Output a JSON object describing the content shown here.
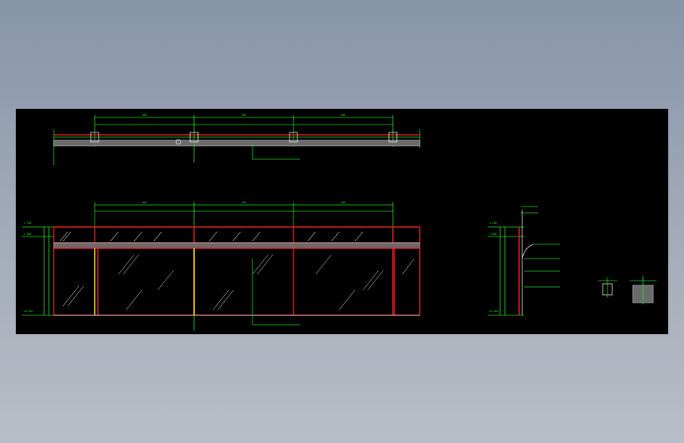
{
  "colors": {
    "canvas": "#000000",
    "dimension": "#22dd22",
    "frame": "#ff2222",
    "post": "#ffe000",
    "annotation": "#e8e8e8"
  },
  "plan_view": {
    "spans": [
      "600",
      "600",
      "600"
    ],
    "notes": [
      "",
      "",
      "",
      ""
    ]
  },
  "elevation_view": {
    "spans": [
      "600",
      "600",
      "600"
    ],
    "levels": [
      "1.200",
      "1.000",
      "±0.000"
    ]
  },
  "section_view": {
    "levels": [
      "1.200",
      "1.000",
      "±0.000"
    ],
    "notes": [
      "",
      "",
      "",
      ""
    ]
  },
  "details": [
    "",
    ""
  ]
}
